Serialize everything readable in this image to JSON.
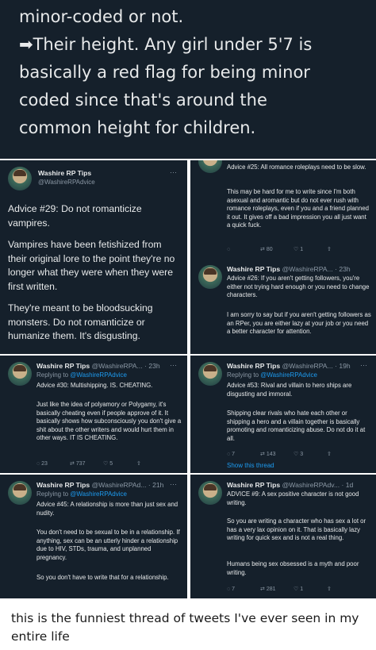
{
  "top": {
    "line1": "minor-coded or not.",
    "line2": "➡Their height. Any girl under 5'7 is",
    "line3": "basically a red flag for being minor",
    "line4": "coded since that's around the",
    "line5": "common height for children."
  },
  "p1": {
    "name": "Washire RP Tips",
    "handle": "@WashireRPAdvice",
    "para1": "Advice #29: Do not romanticize vampires.",
    "para2": "Vampires have been fetishized from their original lore to the point they're no longer what they were when they were first written.",
    "para3": "They're meant to be bloodsucking monsters. Do not romanticize or humanize them. It's disgusting."
  },
  "p2": {
    "head": "Advice #25: All romance roleplays need to be slow.",
    "body": "This may be hard for me to write since I'm both asexual and aromantic but do not ever rush with romance roleplays, even if you and a friend planned it out. It gives off a bad impression you all just want a quick fuck.",
    "retweets": "80",
    "likes": "1",
    "name": "Washire RP Tips",
    "handle": "@WashireRPA...",
    "time": "· 23h",
    "advice": "Advice #26: If you aren't getting followers, you're either not trying hard enough or you need to change characters.",
    "para": "I am sorry to say but if you aren't getting followers as an RPer, you are either lazy at your job or you need a better character for attention."
  },
  "p3": {
    "name": "Washire RP Tips",
    "handle": "@WashireRPA...",
    "time": "· 23h",
    "reply_prefix": "Replying to",
    "reply_to": "@WashireRPAdvice",
    "advice": "Advice #30: Multishipping. IS. CHEATING.",
    "para": "Just like the idea of polyamory or Polygamy, it's basically cheating even if people approve of it. It basically shows how subconsciously you don't give a shit about the other writers and would hurt them in other ways. IT IS CHEATING.",
    "replies": "23",
    "retweets": "737",
    "likes": "5"
  },
  "p4": {
    "name": "Washire RP Tips",
    "handle": "@WashireRPA...",
    "time": "· 19h",
    "reply_prefix": "Replying to",
    "reply_to": "@WashireRPAdvice",
    "advice": "Advice #53: Rival and villain to hero ships are disgusting and immoral.",
    "para": "Shipping clear rivals who hate each other or shipping a hero and a villain together is basically promoting and romanticizing abuse. Do not do it at all.",
    "replies": "7",
    "retweets": "143",
    "likes": "3",
    "show_thread": "Show this thread"
  },
  "p5": {
    "name": "Washire RP Tips",
    "handle": "@WashireRPAd...",
    "time": "· 21h",
    "reply_prefix": "Replying to",
    "reply_to": "@WashireRPAdvice",
    "advice": "Advice #45: A relationship is more than just sex and nudity.",
    "para1": "You don't need to be sexual to be in a relationship. If anything, sex can be an utterly hinder a relationship due to HIV, STDs, trauma, and unplanned pregnancy.",
    "para2": "So you don't have to write that for a relationship."
  },
  "p6": {
    "name": "Washire RP Tips",
    "handle": "@WashireRPAdv...",
    "time": "· 1d",
    "advice": "ADVICE #9: A sex positive character is not good writing.",
    "para1": "So you are writing a character who has sex a lot or has a very lax opinion on it. That is basically lazy writing for quick sex and is not a real thing.",
    "para2": "Humans being sex obsessed is a myth and poor writing.",
    "replies": "7",
    "retweets": "281",
    "likes": "1"
  },
  "caption": "this is the funniest thread of tweets I've ever seen in my entire life"
}
